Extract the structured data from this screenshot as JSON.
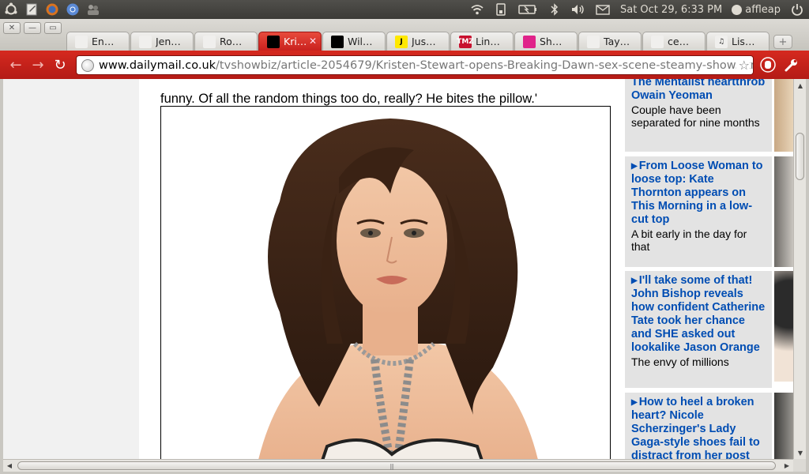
{
  "panel": {
    "clock": "Sat Oct 29,  6:33 PM",
    "user": "affleap"
  },
  "browser": {
    "tabs": [
      {
        "title": "En…",
        "favicon": "",
        "fav_bg": "#f0efed",
        "fav_fg": "#d68a00",
        "active": false
      },
      {
        "title": "Jen…",
        "favicon": "",
        "fav_bg": "#f0efed",
        "fav_fg": "#d68a00",
        "active": false
      },
      {
        "title": "Ro…",
        "favicon": "",
        "fav_bg": "#f0efed",
        "fav_fg": "#e0238a",
        "active": false
      },
      {
        "title": "Kri…",
        "favicon": "",
        "fav_bg": "#000000",
        "fav_fg": "#ffffff",
        "active": true
      },
      {
        "title": "Wil…",
        "favicon": "",
        "fav_bg": "#000000",
        "fav_fg": "#ffffff",
        "active": false
      },
      {
        "title": "Jus…",
        "favicon": "J",
        "fav_bg": "#ffe800",
        "fav_fg": "#000000",
        "active": false
      },
      {
        "title": "Lin…",
        "favicon": "TMZ",
        "fav_bg": "#c8102e",
        "fav_fg": "#ffffff",
        "active": false
      },
      {
        "title": "Sh…",
        "favicon": "",
        "fav_bg": "#e0238a",
        "fav_fg": "#ffffff",
        "active": false
      },
      {
        "title": "Tay…",
        "favicon": "",
        "fav_bg": "#f0efed",
        "fav_fg": "#1a5aa8",
        "active": false
      },
      {
        "title": "ce…",
        "favicon": "",
        "fav_bg": "#f0efed",
        "fav_fg": "#4285f4",
        "active": false
      },
      {
        "title": "Lis…",
        "favicon": "♫",
        "fav_bg": "#f0efed",
        "fav_fg": "#222222",
        "active": false
      }
    ],
    "url_domain": "www.dailymail.co.uk",
    "url_path": "/tvshowbiz/article-2054679/Kristen-Stewart-opens-Breaking-Dawn-sex-scene-steamy-show.html",
    "accent": "#c9211e"
  },
  "article": {
    "paragraph": "funny. Of all the random things too do, really? He bites the pillow.'"
  },
  "sidebar": {
    "items": [
      {
        "headline": "The Mentalist heartthrob Owain Yeoman",
        "desc": "Couple have been separated for nine months",
        "show_arrow": false
      },
      {
        "headline": "From Loose Woman to loose top: Kate Thornton appears on This Morning in a low-cut top",
        "desc": "A bit early in the day for that",
        "show_arrow": true
      },
      {
        "headline": "I'll take some of that! John Bishop reveals how confident Catherine Tate took her chance and SHE asked out lookalike Jason Orange",
        "desc": "The envy of millions",
        "show_arrow": true
      },
      {
        "headline": "How to heel a broken heart? Nicole Scherzinger's Lady Gaga-style shoes fail to distract from her post",
        "desc": "",
        "show_arrow": true
      }
    ]
  }
}
